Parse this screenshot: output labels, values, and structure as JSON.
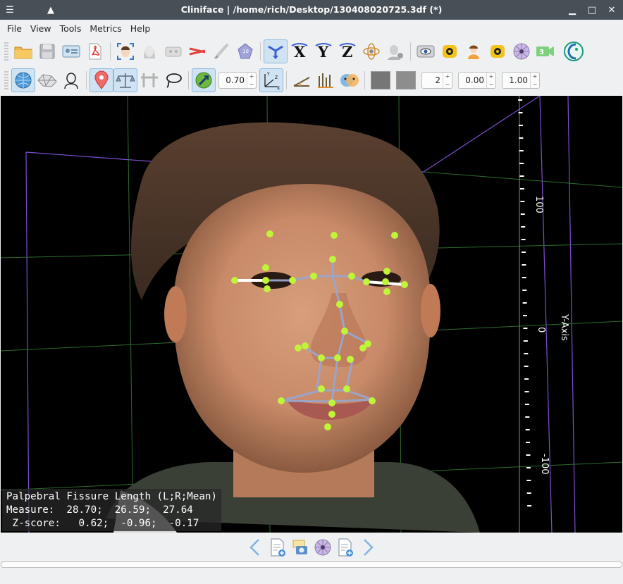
{
  "window": {
    "title": "Cliniface | /home/rich/Desktop/130408020725.3df (*)"
  },
  "menu": [
    "File",
    "View",
    "Tools",
    "Metrics",
    "Help"
  ],
  "toolbar1": {
    "icons": [
      "open-folder-icon",
      "save-icon",
      "id-card-icon",
      "pdf-icon",
      "face-detect-icon",
      "face-icon",
      "mask-icon",
      "scissors-icon",
      "brush-icon",
      "d10-icon",
      "move-icon",
      "x-axis-icon",
      "y-axis-icon",
      "z-axis-icon",
      "orbit-icon",
      "face-gray-icon",
      "eye-camera-icon",
      "camera-icon",
      "person-icon",
      "camera-2-icon",
      "spin-icon",
      "camera-3d-icon",
      "cliniface-logo-icon"
    ],
    "axis_labels": [
      "X",
      "Y",
      "Z"
    ],
    "badge_text": "3"
  },
  "toolbar2": {
    "icons": [
      "globe-icon",
      "mesh-icon",
      "head-outline-icon",
      "landmark-pin-icon",
      "balance-icon",
      "plane-icon",
      "lasso-icon",
      "link-icon",
      "axes-icon",
      "angle-icon",
      "bars-icon",
      "faces-icon"
    ],
    "opacity_value": "0.70",
    "color_a": "#767676",
    "color_b": "#8d8d8d",
    "point_size": "2",
    "value_b": "0.00",
    "value_c": "1.00"
  },
  "viewport": {
    "axis_label": "Y-Axis",
    "ticks": [
      "100",
      "0",
      "-100"
    ],
    "overlay_lines": [
      "Palpebral Fissure Length (L;R;Mean)",
      "Measure:  28.70;  26.59;  27.64",
      " Z-score:   0.62;  -0.96;  -0.17"
    ]
  },
  "bottom": {
    "icons": [
      "prev-arrow-icon",
      "new-doc-icon",
      "snapshot-icon",
      "spin-view-icon",
      "add-doc-icon",
      "next-arrow-icon"
    ]
  }
}
